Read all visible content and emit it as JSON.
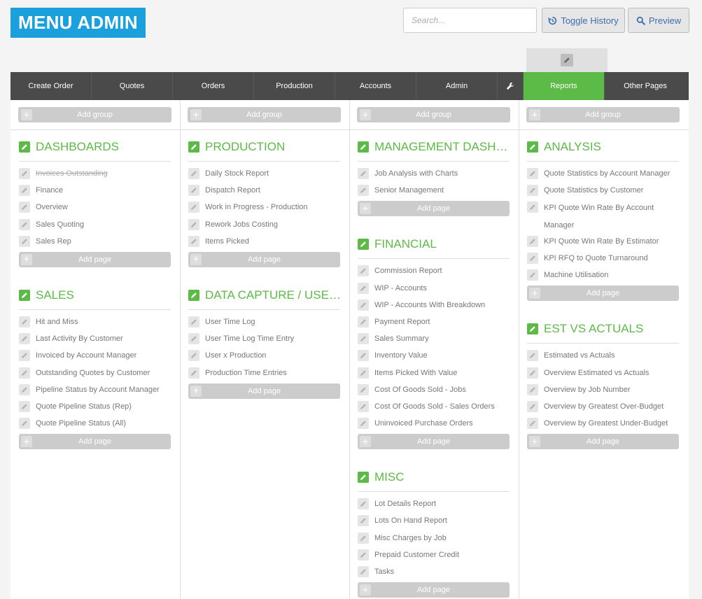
{
  "logo": "MENU ADMIN",
  "search": {
    "placeholder": "Search..."
  },
  "buttons": {
    "toggle_history": "Toggle History",
    "preview": "Preview"
  },
  "nav": {
    "tabs": [
      "Create Order",
      "Quotes",
      "Orders",
      "Production",
      "Accounts",
      "Admin"
    ],
    "active_tab": "Reports",
    "last_tab": "Other Pages"
  },
  "add_group_label": "Add group",
  "add_page_label": "Add page",
  "colors": {
    "brand": "#1aa0dc",
    "accent": "#5cba47",
    "nav_bg": "#4a4a4a"
  },
  "columns": [
    {
      "groups": [
        {
          "title": "DASHBOARDS",
          "items": [
            {
              "label": "Invoices Outstanding",
              "disabled": true
            },
            {
              "label": "Finance"
            },
            {
              "label": "Overview"
            },
            {
              "label": "Sales Quoting"
            },
            {
              "label": "Sales Rep"
            }
          ]
        },
        {
          "title": "SALES",
          "items": [
            {
              "label": "Hit and Miss"
            },
            {
              "label": "Last Activity By Customer"
            },
            {
              "label": "Invoiced by Account Manager"
            },
            {
              "label": "Outstanding Quotes by Customer"
            },
            {
              "label": "Pipeline Status by Account Manager"
            },
            {
              "label": "Quote Pipeline Status (Rep)"
            },
            {
              "label": "Quote Pipeline Status (All)"
            }
          ]
        }
      ]
    },
    {
      "groups": [
        {
          "title": "PRODUCTION",
          "items": [
            {
              "label": "Daily Stock Report"
            },
            {
              "label": "Dispatch Report"
            },
            {
              "label": "Work in Progress - Production"
            },
            {
              "label": "Rework Jobs Costing"
            },
            {
              "label": "Items Picked"
            }
          ]
        },
        {
          "title": "DATA CAPTURE / USER TIME",
          "items": [
            {
              "label": "User Time Log"
            },
            {
              "label": "User Time Log Time Entry"
            },
            {
              "label": "User x Production"
            },
            {
              "label": "Production Time Entries"
            }
          ]
        }
      ]
    },
    {
      "groups": [
        {
          "title": "MANAGEMENT DASHBOARDS",
          "items": [
            {
              "label": "Job Analysis with Charts"
            },
            {
              "label": "Senior Management"
            }
          ]
        },
        {
          "title": "FINANCIAL",
          "items": [
            {
              "label": "Commission Report"
            },
            {
              "label": "WIP - Accounts"
            },
            {
              "label": "WIP - Accounts With Breakdown"
            },
            {
              "label": "Payment Report"
            },
            {
              "label": "Sales Summary"
            },
            {
              "label": "Inventory Value"
            },
            {
              "label": "Items Picked With Value"
            },
            {
              "label": "Cost Of Goods Sold - Jobs"
            },
            {
              "label": "Cost Of Goods Sold - Sales Orders"
            },
            {
              "label": "Uninvoiced Purchase Orders"
            }
          ]
        },
        {
          "title": "MISC",
          "items": [
            {
              "label": "Lot Details Report"
            },
            {
              "label": "Lots On Hand Report"
            },
            {
              "label": "Misc Charges by Job"
            },
            {
              "label": "Prepaid Customer Credit"
            },
            {
              "label": "Tasks"
            }
          ]
        }
      ]
    },
    {
      "groups": [
        {
          "title": "ANALYSIS",
          "items": [
            {
              "label": "Quote Statistics by Account Manager"
            },
            {
              "label": "Quote Statistics by Customer"
            },
            {
              "label": "KPI Quote Win Rate By Account Manager",
              "wrap": true
            },
            {
              "label": "KPI Quote Win Rate By Estimator"
            },
            {
              "label": "KPI RFQ to Quote Turnaround"
            },
            {
              "label": "Machine Utilisation"
            }
          ]
        },
        {
          "title": "EST VS ACTUALS",
          "items": [
            {
              "label": "Estimated vs Actuals"
            },
            {
              "label": "Overview Estimated vs Actuals"
            },
            {
              "label": "Overview by Job Number"
            },
            {
              "label": "Overview by Greatest Over-Budget"
            },
            {
              "label": "Overview by Greatest Under-Budget"
            }
          ]
        }
      ]
    }
  ]
}
